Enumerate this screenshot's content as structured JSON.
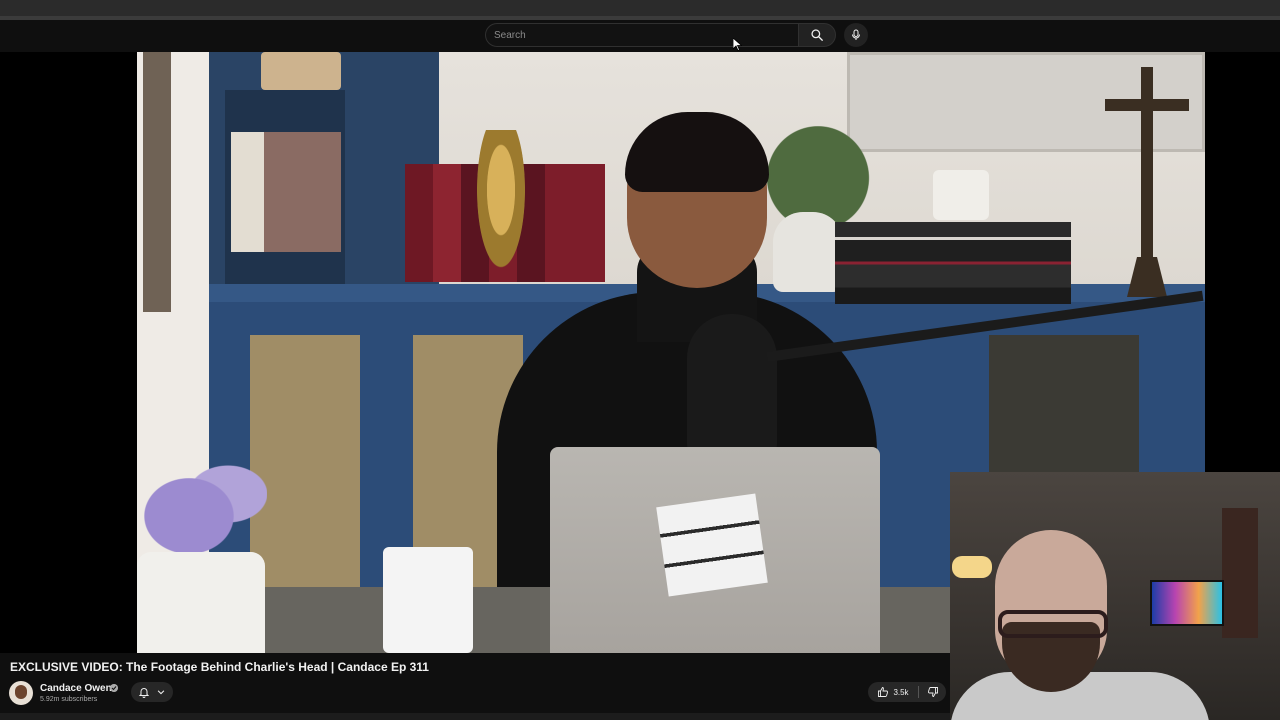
{
  "search": {
    "placeholder": "Search"
  },
  "video": {
    "title": "EXCLUSIVE VIDEO: The Footage Behind Charlie's Head | Candace Ep 311"
  },
  "channel": {
    "name": "Candace Owens",
    "subscribers": "5.92m subscribers"
  },
  "actions": {
    "like_count": "3.5k"
  },
  "icons": {
    "search": "search-icon",
    "mic": "mic-icon",
    "bell": "bell-icon",
    "chevron": "chevron-down-icon",
    "like": "thumbs-up-icon",
    "dislike": "thumbs-down-icon",
    "verified": "verified-icon"
  }
}
